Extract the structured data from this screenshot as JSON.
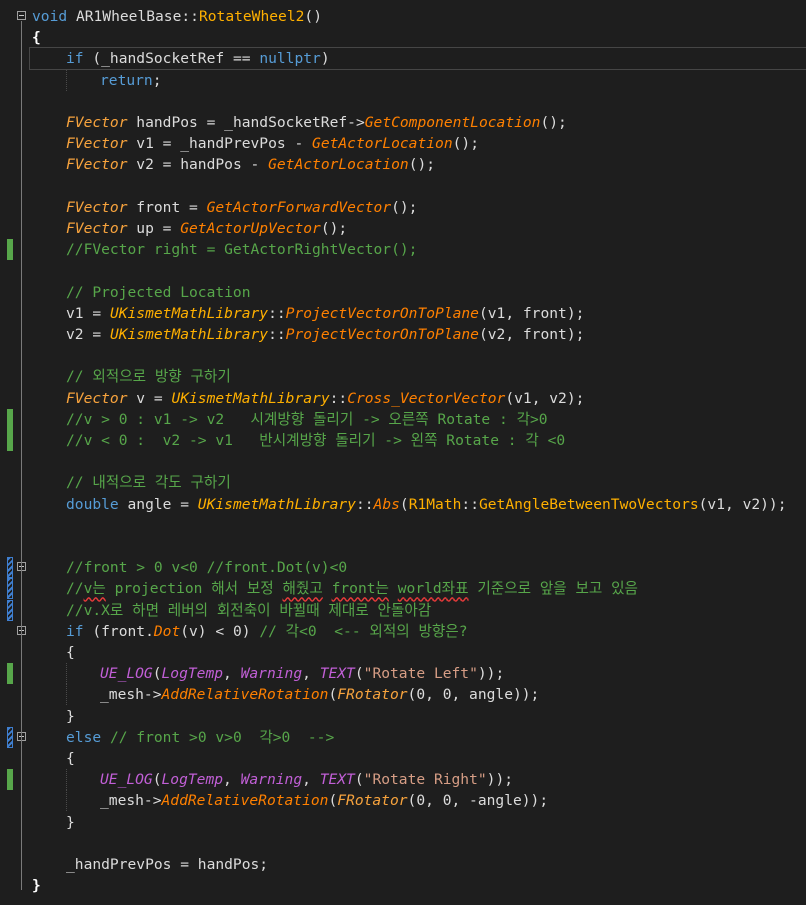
{
  "editor": {
    "lines": [
      {
        "n": 1,
        "ind": 0,
        "tokens": [
          [
            "kw",
            "void"
          ],
          [
            "pl",
            " AR1WheelBase"
          ],
          [
            "pl",
            "::"
          ],
          [
            "fn2",
            "RotateWheel2"
          ],
          [
            "pl",
            "()"
          ]
        ]
      },
      {
        "n": 2,
        "ind": 0,
        "tokens": [
          [
            "br",
            "{"
          ]
        ]
      },
      {
        "n": 3,
        "ind": 1,
        "tokens": [
          [
            "kw",
            "if"
          ],
          [
            "pl",
            " (_handSocketRef == "
          ],
          [
            "kw",
            "nullptr"
          ],
          [
            "pl",
            ")"
          ]
        ]
      },
      {
        "n": 4,
        "ind": 2,
        "tokens": [
          [
            "kw",
            "return"
          ],
          [
            "pl",
            ";"
          ]
        ]
      },
      {
        "n": 5,
        "ind": 0,
        "tokens": []
      },
      {
        "n": 6,
        "ind": 1,
        "tokens": [
          [
            "ty",
            "FVector"
          ],
          [
            "pl",
            " handPos = _handSocketRef->"
          ],
          [
            "fn",
            "GetComponentLocation"
          ],
          [
            "pl",
            "();"
          ]
        ]
      },
      {
        "n": 7,
        "ind": 1,
        "tokens": [
          [
            "ty",
            "FVector"
          ],
          [
            "pl",
            " v1 = _handPrevPos - "
          ],
          [
            "fn",
            "GetActorLocation"
          ],
          [
            "pl",
            "();"
          ]
        ]
      },
      {
        "n": 8,
        "ind": 1,
        "tokens": [
          [
            "ty",
            "FVector"
          ],
          [
            "pl",
            " v2 = handPos - "
          ],
          [
            "fn",
            "GetActorLocation"
          ],
          [
            "pl",
            "();"
          ]
        ]
      },
      {
        "n": 9,
        "ind": 0,
        "tokens": []
      },
      {
        "n": 10,
        "ind": 1,
        "tokens": [
          [
            "ty",
            "FVector"
          ],
          [
            "pl",
            " front = "
          ],
          [
            "fn",
            "GetActorForwardVector"
          ],
          [
            "pl",
            "();"
          ]
        ]
      },
      {
        "n": 11,
        "ind": 1,
        "tokens": [
          [
            "ty",
            "FVector"
          ],
          [
            "pl",
            " up = "
          ],
          [
            "fn",
            "GetActorUpVector"
          ],
          [
            "pl",
            "();"
          ]
        ]
      },
      {
        "n": 12,
        "ind": 1,
        "tokens": [
          [
            "cm",
            "//FVector right = GetActorRightVector();"
          ]
        ]
      },
      {
        "n": 13,
        "ind": 0,
        "tokens": []
      },
      {
        "n": 14,
        "ind": 1,
        "tokens": [
          [
            "cm",
            "// Projected Location"
          ]
        ]
      },
      {
        "n": 15,
        "ind": 1,
        "tokens": [
          [
            "pl",
            "v1 = "
          ],
          [
            "cls",
            "UKismetMathLibrary"
          ],
          [
            "pl",
            "::"
          ],
          [
            "fn",
            "ProjectVectorOnToPlane"
          ],
          [
            "pl",
            "(v1, front);"
          ]
        ]
      },
      {
        "n": 16,
        "ind": 1,
        "tokens": [
          [
            "pl",
            "v2 = "
          ],
          [
            "cls",
            "UKismetMathLibrary"
          ],
          [
            "pl",
            "::"
          ],
          [
            "fn",
            "ProjectVectorOnToPlane"
          ],
          [
            "pl",
            "(v2, front);"
          ]
        ]
      },
      {
        "n": 17,
        "ind": 0,
        "tokens": []
      },
      {
        "n": 18,
        "ind": 1,
        "tokens": [
          [
            "cm",
            "// 외적으로 방향 구하기"
          ]
        ]
      },
      {
        "n": 19,
        "ind": 1,
        "tokens": [
          [
            "ty",
            "FVector"
          ],
          [
            "pl",
            " v = "
          ],
          [
            "cls",
            "UKismetMathLibrary"
          ],
          [
            "pl",
            "::"
          ],
          [
            "fn",
            "Cross_VectorVector"
          ],
          [
            "pl",
            "(v1, v2);"
          ]
        ]
      },
      {
        "n": 20,
        "ind": 1,
        "tokens": [
          [
            "cm",
            "//v > 0 : v1 -> v2   시계방향 돌리기 -> 오른쪽 Rotate : 각>0"
          ]
        ]
      },
      {
        "n": 21,
        "ind": 1,
        "tokens": [
          [
            "cm",
            "//v < 0 :  v2 -> v1   반시계방향 돌리기 -> 왼쪽 Rotate : 각 <0"
          ]
        ]
      },
      {
        "n": 22,
        "ind": 0,
        "tokens": []
      },
      {
        "n": 23,
        "ind": 1,
        "tokens": [
          [
            "cm",
            "// 내적으로 각도 구하기"
          ]
        ]
      },
      {
        "n": 24,
        "ind": 1,
        "tokens": [
          [
            "kw",
            "double"
          ],
          [
            "pl",
            " angle = "
          ],
          [
            "cls",
            "UKismetMathLibrary"
          ],
          [
            "pl",
            "::"
          ],
          [
            "fn",
            "Abs"
          ],
          [
            "pl",
            "("
          ],
          [
            "ns",
            "R1Math"
          ],
          [
            "pl",
            "::"
          ],
          [
            "fn2",
            "GetAngleBetweenTwoVectors"
          ],
          [
            "pl",
            "(v1, v2));"
          ]
        ]
      },
      {
        "n": 25,
        "ind": 0,
        "tokens": []
      },
      {
        "n": 26,
        "ind": 0,
        "tokens": []
      },
      {
        "n": 27,
        "ind": 1,
        "tokens": [
          [
            "cm",
            "//front > 0 v<0 //front.Dot(v)<0"
          ]
        ]
      },
      {
        "n": 28,
        "ind": 1,
        "tokens": [
          [
            "cm",
            "//"
          ],
          [
            "cmsq",
            "v는"
          ],
          [
            "cm",
            " projection 해서 보정 "
          ],
          [
            "cmsq",
            "해줬고"
          ],
          [
            "cm",
            " "
          ],
          [
            "cmsq",
            "front는"
          ],
          [
            "cm",
            " "
          ],
          [
            "cmsq",
            "world좌표"
          ],
          [
            "cm",
            " 기준으로 앞을 보고 있음"
          ]
        ]
      },
      {
        "n": 29,
        "ind": 1,
        "tokens": [
          [
            "cm",
            "//v.X로 하면 레버의 회전축이 바뀔때 제대로 안돌아감"
          ]
        ]
      },
      {
        "n": 30,
        "ind": 1,
        "tokens": [
          [
            "kw",
            "if"
          ],
          [
            "pl",
            " (front."
          ],
          [
            "fn",
            "Dot"
          ],
          [
            "pl",
            "(v) < 0) "
          ],
          [
            "cm",
            "// 각<0  <-- 외적의 방향은?"
          ]
        ]
      },
      {
        "n": 31,
        "ind": 1,
        "tokens": [
          [
            "pl",
            "{"
          ]
        ]
      },
      {
        "n": 32,
        "ind": 2,
        "tokens": [
          [
            "mac",
            "UE_LOG"
          ],
          [
            "pl",
            "("
          ],
          [
            "mac",
            "LogTemp"
          ],
          [
            "pl",
            ", "
          ],
          [
            "mac",
            "Warning"
          ],
          [
            "pl",
            ", "
          ],
          [
            "mac",
            "TEXT"
          ],
          [
            "pl",
            "("
          ],
          [
            "st",
            "\"Rotate Left\""
          ],
          [
            "pl",
            "));"
          ]
        ]
      },
      {
        "n": 33,
        "ind": 2,
        "tokens": [
          [
            "pl",
            "_mesh->"
          ],
          [
            "fn",
            "AddRelativeRotation"
          ],
          [
            "pl",
            "("
          ],
          [
            "ty",
            "FRotator"
          ],
          [
            "pl",
            "(0, 0, angle));"
          ]
        ]
      },
      {
        "n": 34,
        "ind": 1,
        "tokens": [
          [
            "pl",
            "}"
          ]
        ]
      },
      {
        "n": 35,
        "ind": 1,
        "tokens": [
          [
            "kw",
            "else"
          ],
          [
            "pl",
            " "
          ],
          [
            "cm",
            "// front >0 v>0  각>0  -->"
          ]
        ]
      },
      {
        "n": 36,
        "ind": 1,
        "tokens": [
          [
            "pl",
            "{"
          ]
        ]
      },
      {
        "n": 37,
        "ind": 2,
        "tokens": [
          [
            "mac",
            "UE_LOG"
          ],
          [
            "pl",
            "("
          ],
          [
            "mac",
            "LogTemp"
          ],
          [
            "pl",
            ", "
          ],
          [
            "mac",
            "Warning"
          ],
          [
            "pl",
            ", "
          ],
          [
            "mac",
            "TEXT"
          ],
          [
            "pl",
            "("
          ],
          [
            "st",
            "\"Rotate Right\""
          ],
          [
            "pl",
            "));"
          ]
        ]
      },
      {
        "n": 38,
        "ind": 2,
        "tokens": [
          [
            "pl",
            "_mesh->"
          ],
          [
            "fn",
            "AddRelativeRotation"
          ],
          [
            "pl",
            "("
          ],
          [
            "ty",
            "FRotator"
          ],
          [
            "pl",
            "(0, 0, -angle));"
          ]
        ]
      },
      {
        "n": 39,
        "ind": 1,
        "tokens": [
          [
            "pl",
            "}"
          ]
        ]
      },
      {
        "n": 40,
        "ind": 0,
        "tokens": []
      },
      {
        "n": 41,
        "ind": 1,
        "tokens": [
          [
            "pl",
            "_handPrevPos = handPos;"
          ]
        ]
      },
      {
        "n": 42,
        "ind": 0,
        "tokens": [
          [
            "br",
            "}"
          ]
        ]
      }
    ],
    "markers": {
      "green": [
        12,
        20,
        21,
        32,
        37
      ],
      "blue": [
        27,
        28,
        29,
        35
      ],
      "fold": [
        1,
        27,
        30,
        35
      ],
      "current": 3
    },
    "colors": {
      "background": "#1e1e1e",
      "keyword": "#569cd6",
      "comment": "#57a64a",
      "type": "#f7a33d",
      "function": "#ff8000",
      "macro": "#c15fd6",
      "string": "#d69d85"
    }
  }
}
